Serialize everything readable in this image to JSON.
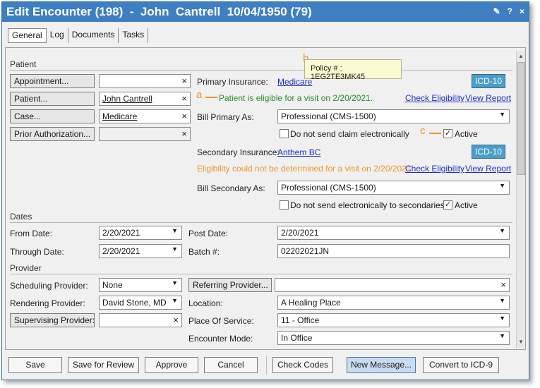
{
  "window": {
    "title": "Edit Encounter (198)  -  John  Cantrell  10/04/1950 (79)",
    "icons": [
      "edit-icon",
      "help-icon",
      "close-icon"
    ],
    "help_label": "?",
    "close_label": "×"
  },
  "tabs": [
    "General",
    "Log",
    "Documents",
    "Tasks"
  ],
  "patient_section": {
    "heading": "Patient",
    "appointment_label": "Appointment...",
    "appointment_value": "",
    "patient_label": "Patient...",
    "patient_value": "John  Cantrell",
    "case_label": "Case...",
    "case_value": "Medicare",
    "prior_auth_label": "Prior Authorization...",
    "prior_auth_value": "",
    "clear_glyph": "×"
  },
  "insurance": {
    "primary_label": "Primary Insurance:",
    "primary_value": "Medicare",
    "primary_icd": "ICD-10",
    "primary_eligibility_msg": "Patient is eligible for a visit on 2/20/2021.",
    "check_eligibility": "Check Eligibility",
    "view_report": "View Report",
    "bill_primary_label": "Bill Primary As:",
    "bill_primary_value": "Professional (CMS-1500)",
    "no_send_primary_label": "Do not send claim electronically",
    "no_send_primary_checked": false,
    "primary_active_label": "Active",
    "primary_active_checked": true,
    "secondary_label": "Secondary Insurance:",
    "secondary_value": "Anthem BC",
    "secondary_icd": "ICD-10",
    "secondary_eligibility_msg": "Eligibility could not be determined for a visit on 2/20/2021.",
    "bill_secondary_label": "Bill Secondary As:",
    "bill_secondary_value": "Professional (CMS-1500)",
    "no_send_secondary_label": "Do not send electronically to secondaries",
    "no_send_secondary_checked": false,
    "secondary_active_label": "Active",
    "secondary_active_checked": true
  },
  "tooltip": {
    "text": "Policy # : 1EG2TE3MK45"
  },
  "annotations": {
    "a": "a",
    "b": "b",
    "c": "c"
  },
  "dates": {
    "heading": "Dates",
    "from_label": "From Date:",
    "from_value": "2/20/2021",
    "through_label": "Through Date:",
    "through_value": "2/20/2021",
    "post_label": "Post Date:",
    "post_value": "2/20/2021",
    "batch_label": "Batch #:",
    "batch_value": "02202021JN"
  },
  "provider": {
    "heading": "Provider",
    "scheduling_label": "Scheduling Provider:",
    "scheduling_value": "None",
    "rendering_label": "Rendering Provider:",
    "rendering_value": "David Stone, MD",
    "supervising_label": "Supervising Provider:",
    "supervising_value": "",
    "referring_label": "Referring Provider...",
    "referring_value": "",
    "location_label": "Location:",
    "location_value": "A Healing Place",
    "pos_label": "Place Of Service:",
    "pos_value": "11 - Office",
    "mode_label": "Encounter Mode:",
    "mode_value": "In Office"
  },
  "footer": {
    "save": "Save",
    "save_review": "Save for Review",
    "approve": "Approve",
    "cancel": "Cancel",
    "check_codes": "Check Codes",
    "new_message": "New Message...",
    "convert": "Convert to ICD-9"
  },
  "colors": {
    "titlebar": "#3d7fc1",
    "link": "#1a2fc4",
    "eligible": "#2a8a2a",
    "warning": "#e8962a",
    "icd": "#4a9ec9"
  }
}
